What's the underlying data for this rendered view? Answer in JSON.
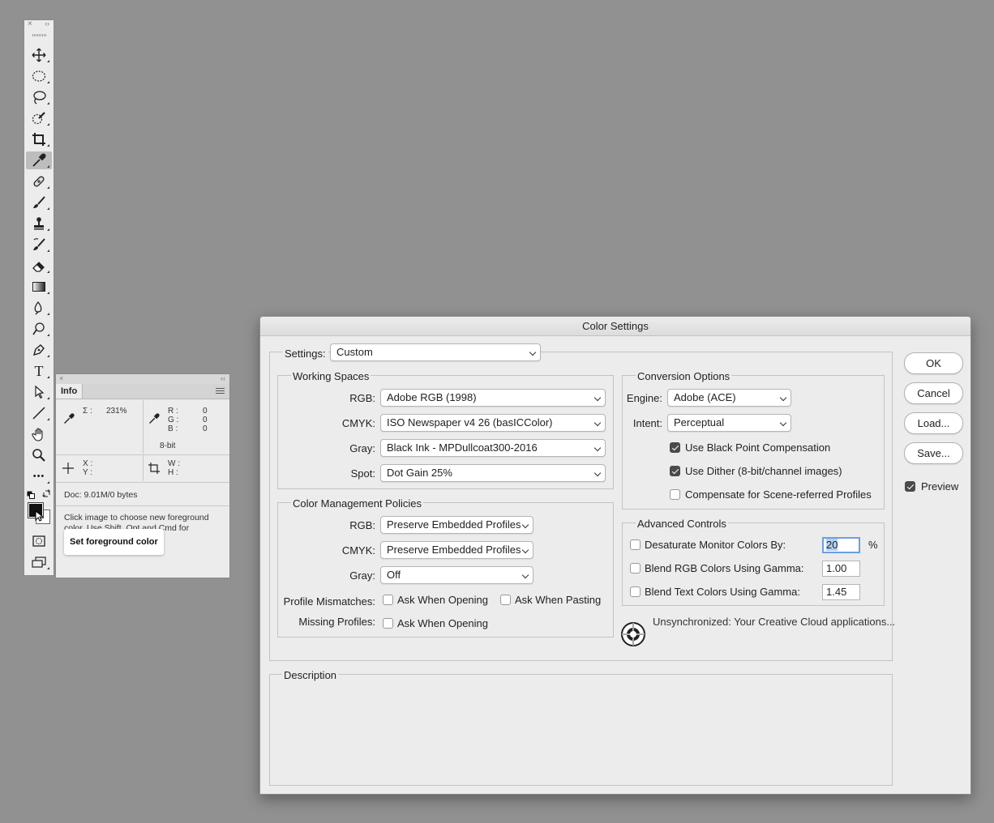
{
  "tools_panel": {
    "close_glyph": "×",
    "collapse_glyph": "››",
    "tools": [
      "move-icon",
      "ellipse-marquee-icon",
      "lasso-icon",
      "quick-selection-icon",
      "crop-icon",
      "eyedropper-icon",
      "healing-brush-icon",
      "brush-icon",
      "clone-stamp-icon",
      "history-brush-icon",
      "eraser-icon",
      "gradient-icon",
      "blur-icon",
      "dodge-icon",
      "pen-icon",
      "type-icon",
      "path-selection-icon",
      "line-icon",
      "hand-icon",
      "zoom-icon",
      "more-tools-icon"
    ],
    "selected_tool": "eyedropper-icon",
    "type_tool_glyph": "T",
    "more_glyph": "•••"
  },
  "info_panel": {
    "close_glyph": "×",
    "collapse_glyph": "‹‹",
    "tab_label": "Info",
    "sigma_label": "Σ :",
    "sigma_value": "231%",
    "r_label": "R :",
    "g_label": "G :",
    "b_label": "B :",
    "r_value": "0",
    "g_value": "0",
    "b_value": "0",
    "bit_depth": "8-bit",
    "x_label": "X :",
    "y_label": "Y :",
    "w_label": "W :",
    "h_label": "H :",
    "doc_size": "Doc: 9.01M/0 bytes",
    "hint_text": "Click image to choose new foreground color.  Use Shift, Opt and Cmd for",
    "tooltip": "Set foreground color"
  },
  "dialog": {
    "title": "Color Settings",
    "settings_label": "Settings:",
    "settings_value": "Custom",
    "working_spaces": {
      "title": "Working Spaces",
      "rgb_label": "RGB:",
      "rgb_value": "Adobe RGB (1998)",
      "cmyk_label": "CMYK:",
      "cmyk_value": "ISO Newspaper v4 26 (basICColor)",
      "gray_label": "Gray:",
      "gray_value": "Black Ink - MPDullcoat300-2016",
      "spot_label": "Spot:",
      "spot_value": "Dot Gain 25%"
    },
    "policies": {
      "title": "Color Management Policies",
      "rgb_label": "RGB:",
      "rgb_value": "Preserve Embedded Profiles",
      "cmyk_label": "CMYK:",
      "cmyk_value": "Preserve Embedded Profiles",
      "gray_label": "Gray:",
      "gray_value": "Off",
      "mismatch_label": "Profile Mismatches:",
      "mismatch_open": "Ask When Opening",
      "mismatch_paste": "Ask When Pasting",
      "missing_label": "Missing Profiles:",
      "missing_open": "Ask When Opening"
    },
    "conversion": {
      "title": "Conversion Options",
      "engine_label": "Engine:",
      "engine_value": "Adobe (ACE)",
      "intent_label": "Intent:",
      "intent_value": "Perceptual",
      "bpc": "Use Black Point Compensation",
      "dither": "Use Dither (8-bit/channel images)",
      "scene": "Compensate for Scene-referred Profiles"
    },
    "advanced": {
      "title": "Advanced Controls",
      "desaturate": "Desaturate Monitor Colors By:",
      "desaturate_value": "20",
      "percent": "%",
      "blend_rgb": "Blend RGB Colors Using Gamma:",
      "blend_rgb_value": "1.00",
      "blend_text": "Blend Text Colors Using Gamma:",
      "blend_text_value": "1.45"
    },
    "sync_status": "Unsynchronized: Your Creative Cloud applications...",
    "description_title": "Description",
    "buttons": {
      "ok": "OK",
      "cancel": "Cancel",
      "load": "Load...",
      "save": "Save..."
    },
    "preview_label": "Preview",
    "checkbox_states": {
      "bpc": true,
      "dither": true,
      "scene": false,
      "desaturate": false,
      "blend_rgb": false,
      "blend_text": false,
      "mismatch_open": false,
      "mismatch_paste": false,
      "missing_open": false,
      "preview": true
    }
  }
}
